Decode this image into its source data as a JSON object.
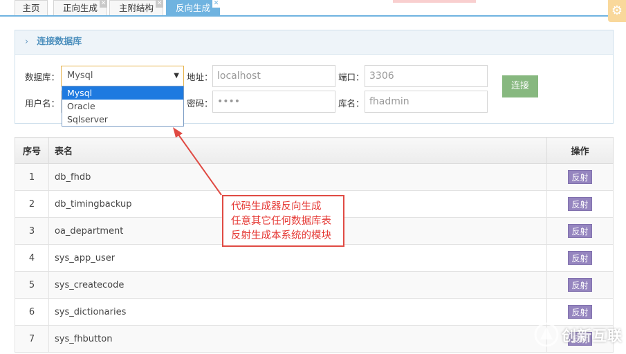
{
  "tabs": [
    {
      "label": "主页",
      "active": false,
      "closable": false
    },
    {
      "label": "正向生成",
      "active": false,
      "closable": true
    },
    {
      "label": "主附结构",
      "active": false,
      "closable": true
    },
    {
      "label": "反向生成",
      "active": true,
      "closable": true
    }
  ],
  "panel": {
    "title": "连接数据库",
    "db_label": "数据库：",
    "db_selected": "Mysql",
    "db_options": [
      "Mysql",
      "Oracle",
      "Sqlserver"
    ],
    "address_label": "地址：",
    "address_value": "localhost",
    "port_label": "端口：",
    "port_value": "3306",
    "user_label": "用户名：",
    "password_label": "密码：",
    "password_value": "••••",
    "dbname_label": "库名：",
    "dbname_value": "fhadmin",
    "connect_label": "连接"
  },
  "table": {
    "headers": {
      "index": "序号",
      "name": "表名",
      "action": "操作"
    },
    "action_label": "反射",
    "rows": [
      {
        "index": "1",
        "name": "db_fhdb"
      },
      {
        "index": "2",
        "name": "db_timingbackup"
      },
      {
        "index": "3",
        "name": "oa_department"
      },
      {
        "index": "4",
        "name": "sys_app_user"
      },
      {
        "index": "5",
        "name": "sys_createcode"
      },
      {
        "index": "6",
        "name": "sys_dictionaries"
      },
      {
        "index": "7",
        "name": "sys_fhbutton"
      }
    ]
  },
  "annotation": {
    "lines": [
      "代码生成器反向生成",
      "任意其它任何数据库表",
      "反射生成本系统的模块"
    ],
    "color": "#e53935"
  },
  "watermark": {
    "text": "创新互联"
  },
  "colors": {
    "accent": "#6fb3e0",
    "connect": "#87b87f",
    "reflect": "#9585bf"
  },
  "icons": {
    "settings": "gear-icon",
    "panel_toggle": "chevron-right-icon"
  }
}
